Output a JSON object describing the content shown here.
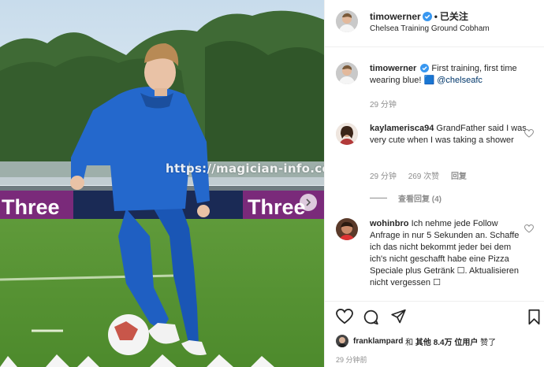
{
  "photo": {
    "sponsor_left": "Three",
    "sponsor_right": "Three",
    "watermark": "https://magician-info.com/"
  },
  "header": {
    "username": "timowerner",
    "dot": "•",
    "follow_label": "已关注",
    "location": "Chelsea Training Ground Cobham"
  },
  "caption": {
    "username": "timowerner",
    "text": "First training, first time wearing blue! 🟦",
    "mention": "@chelseafc",
    "time": "29 分钟"
  },
  "comments": [
    {
      "username": "kaylamerisca94",
      "text": "GrandFather said I was very cute when I was taking a shower",
      "time": "29 分钟",
      "likes": "269 次赞",
      "reply": "回复",
      "view_replies": "查看回复 (4)"
    },
    {
      "username": "wohinbro",
      "text": "Ich nehme jede Follow Anfrage in nur 5 Sekunden an. Schaffe ich das nicht bekommt jeder bei dem ich's nicht geschafft habe eine Pizza Speciale plus Getränk ☐. Aktualisieren nicht vergessen ☐"
    }
  ],
  "likes_line": {
    "user": "franklampard",
    "and": "和",
    "others": "其他 8.4万 位用户",
    "suffix": "赞了"
  },
  "timestamp": "29 分钟前",
  "colors": {
    "verified": "#3897f0",
    "mention": "#00376b",
    "muted": "#8e8e8e"
  }
}
